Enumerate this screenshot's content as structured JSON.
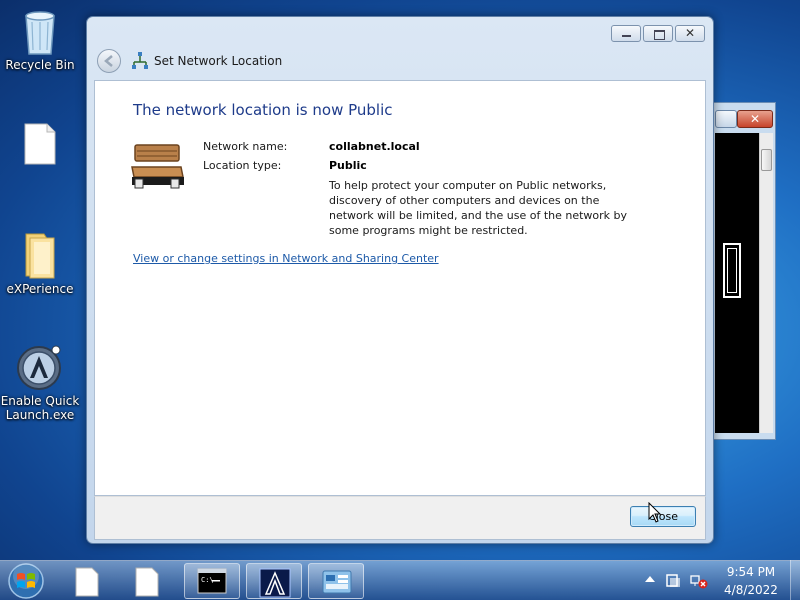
{
  "desktop": {
    "icons": [
      {
        "label": "Recycle Bin"
      },
      {
        "label": ""
      },
      {
        "label": "eXPerience"
      },
      {
        "label": "Enable Quick Launch.exe"
      }
    ]
  },
  "dialog": {
    "title": "Set Network Location",
    "close_glyph": "✕",
    "heading": "The network location is now Public",
    "network_name_label": "Network name:",
    "network_name_value": "collabnet.local",
    "location_type_label": "Location type:",
    "location_type_value": "Public",
    "description": "To help protect your computer on Public networks, discovery of other computers and devices on the network will be limited, and the use of the network by some programs might be restricted.",
    "settings_link": "View or change settings in Network and Sharing Center",
    "close_button": "Close"
  },
  "console_window": {
    "close_glyph": "✕"
  },
  "taskbar": {
    "items": [
      "file",
      "file",
      "command-prompt",
      "app-a",
      "network-control-panel"
    ],
    "clock_time": "9:54 PM",
    "clock_date": "4/8/2022"
  },
  "colors": {
    "heading": "#1e3b8a",
    "link": "#1d5aa8",
    "desktop_blue": "#1f6fc4"
  }
}
